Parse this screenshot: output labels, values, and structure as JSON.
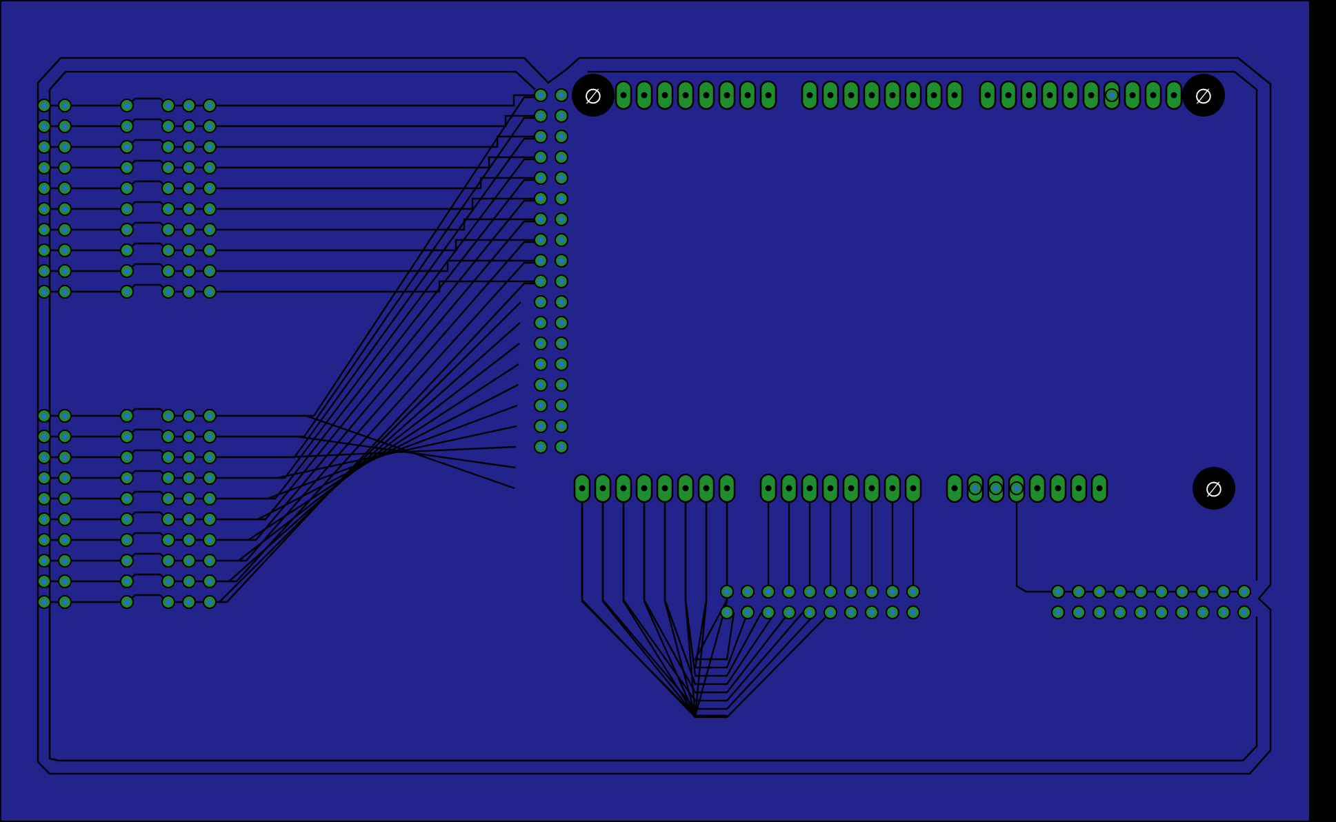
{
  "board": {
    "background_color": "#000000",
    "copper_color": "#23238c",
    "trace_color": "#000000",
    "pad_color": "#1f8c2e",
    "pad_ring_color": "#0c3a14",
    "hole_color": "#000000",
    "via_color": "#2b6cc9"
  },
  "mounting_hole_symbol": "∅",
  "header_left_pins": 36,
  "pin_rows_per_bank": 10,
  "top_connectors": [
    8,
    8,
    10
  ],
  "bottom_connectors": [
    8,
    8,
    8
  ]
}
